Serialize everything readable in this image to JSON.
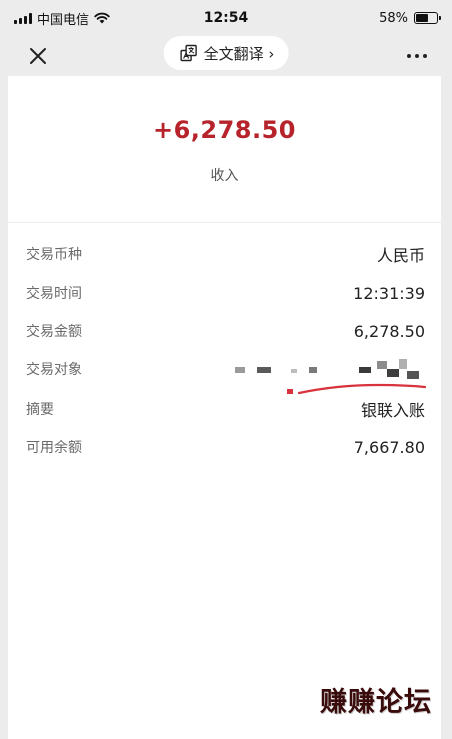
{
  "status_bar": {
    "carrier": "中国电信",
    "time": "12:54",
    "battery_percent": "58%",
    "battery_level": 0.58
  },
  "nav": {
    "translate_label": "全文翻译 ›"
  },
  "transaction": {
    "amount": "+6,278.50",
    "amount_label": "收入",
    "amount_color": "#b6232a"
  },
  "details": [
    {
      "label": "交易币种",
      "value": "人民币"
    },
    {
      "label": "交易时间",
      "value": "12:31:39"
    },
    {
      "label": "交易金额",
      "value": "6,278.50"
    },
    {
      "label": "交易对象",
      "value": ""
    },
    {
      "label": "摘要",
      "value": "银联入账"
    },
    {
      "label": "可用余额",
      "value": "7,667.80"
    }
  ],
  "watermark": "赚赚论坛"
}
